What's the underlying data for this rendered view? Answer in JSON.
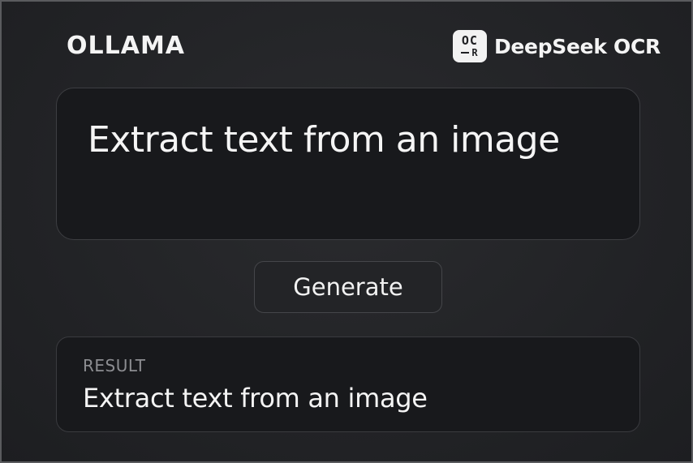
{
  "header": {
    "brand": "OLLAMA",
    "product_icon": "ocr-badge-icon",
    "product_icon_text_top": "OC",
    "product_icon_text_bottom": "R",
    "product_name": "DeepSeek OCR"
  },
  "prompt": {
    "value": "Extract text from an image"
  },
  "actions": {
    "generate_label": "Generate"
  },
  "result": {
    "label": "RESULT",
    "text": "Extract text from an image"
  },
  "colors": {
    "background": "#202124",
    "panel": "#18191c",
    "border": "#3d3e42",
    "text": "#f4f4f4",
    "muted": "#8c8d91"
  }
}
